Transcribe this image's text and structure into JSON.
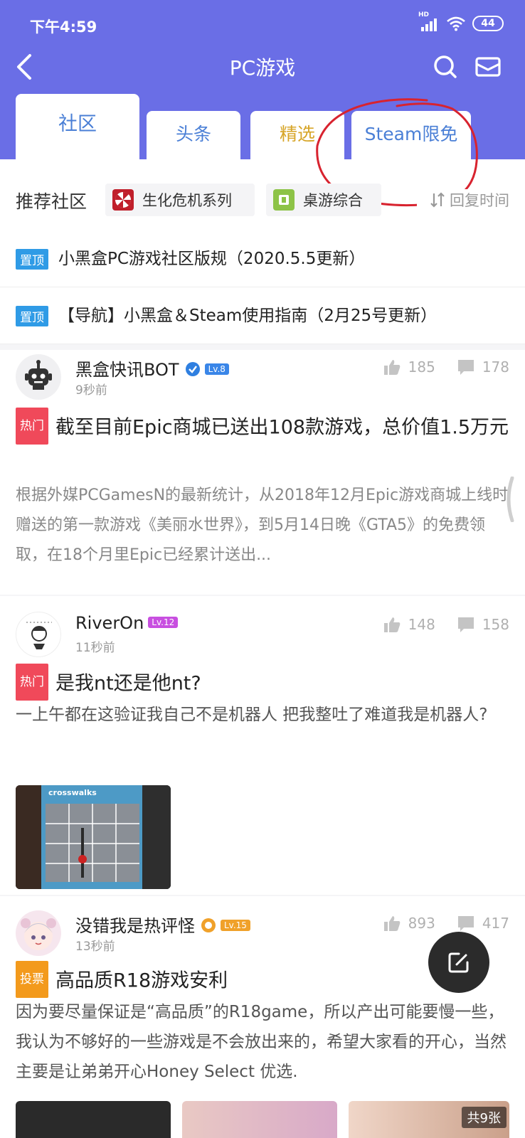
{
  "status_bar": {
    "time": "下午4:59",
    "signal_label": "HD",
    "battery": "44"
  },
  "nav": {
    "title": "PC游戏"
  },
  "tabs": [
    {
      "label": "社区"
    },
    {
      "label": "头条"
    },
    {
      "label": "精选"
    },
    {
      "label": "Steam限免"
    }
  ],
  "recommend": {
    "label": "推荐社区",
    "chips": [
      {
        "label": "生化危机系列"
      },
      {
        "label": "桌游综合"
      }
    ],
    "sort_label": "回复时间"
  },
  "pinned": [
    {
      "badge": "置顶",
      "text": "小黑盒PC游戏社区版规（2020.5.5更新）"
    },
    {
      "badge": "置顶",
      "text": "【导航】小黑盒＆Steam使用指南（2月25号更新）"
    }
  ],
  "posts": [
    {
      "username": "黑盒快讯BOT",
      "level": "Lv.8",
      "time": "9秒前",
      "likes": "185",
      "comments": "178",
      "badge": "热门",
      "title": "截至目前Epic商城已送出108款游戏，总价值1.5万元",
      "body": "根据外媒PCGamesN的最新统计，从2018年12月Epic游戏商城上线时赠送的第一款游戏《美丽水世界》，到5月14日晚《GTA5》的免费领取，在18个月里Epic已经累计送出..."
    },
    {
      "username": "RiverOn",
      "level": "Lv.12",
      "time": "11秒前",
      "likes": "148",
      "comments": "158",
      "badge": "热门",
      "title": "是我nt还是他nt?",
      "body": "一上午都在这验证我自己不是机器人 把我整吐了难道我是机器人?",
      "image_caption": "crosswalks"
    },
    {
      "username": "没错我是热评怪",
      "level": "Lv.15",
      "time": "13秒前",
      "likes": "893",
      "comments": "417",
      "badge": "投票",
      "title": "高品质R18游戏安利",
      "body": "因为要尽量保证是“高品质”的R18game，所以产出可能要慢一些，我认为不够好的一些游戏是不会放出来的，希望大家看的开心，当然主要是让弟弟开心Honey Select 优选."
    }
  ],
  "image_count": "共9张",
  "colors": {
    "header": "#6a6ee6",
    "accent_blue": "#4a7fd6",
    "hot_red": "#f0495a",
    "pin_blue": "#2f9be6",
    "vote_orange": "#f39a1c",
    "annotation_red": "#d8232f"
  }
}
